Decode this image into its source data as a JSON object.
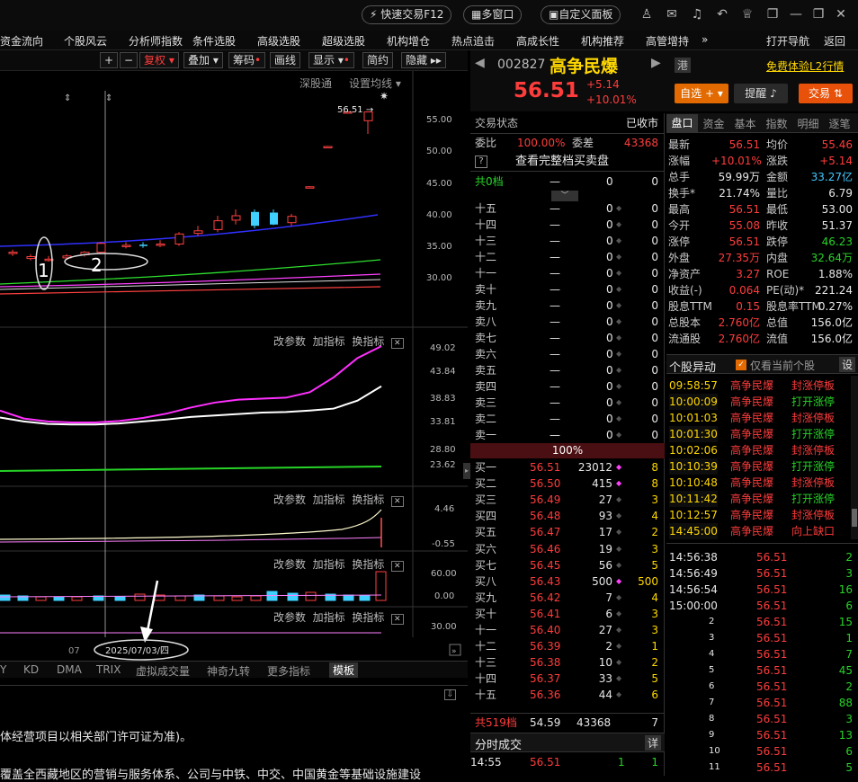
{
  "toolbar": {
    "quick_trade": "快速交易F12",
    "multi_window": "多窗口",
    "custom_panel": "自定义面板"
  },
  "menu": [
    "资金流向",
    "个股风云",
    "分析师指数",
    "条件选股",
    "高级选股",
    "超级选股",
    "机构增仓",
    "热点追击",
    "高成长性",
    "机构推荐",
    "高管增持",
    "»",
    "打开导航",
    "返回"
  ],
  "chart_toolbar": {
    "fuquan": "复权",
    "diejia": "叠加",
    "chouma": "筹码",
    "huaxian": "画线",
    "xianshi": "显示",
    "jianyue": "简约",
    "yincang": "隐藏"
  },
  "chart_sub": {
    "shengang": "深股通",
    "junxian": "设置均线"
  },
  "price_axis": [
    "55.00",
    "50.00",
    "45.00",
    "40.00",
    "35.00",
    "30.00"
  ],
  "last_price_label": "56.51",
  "annotations": {
    "one": "1",
    "two": "2"
  },
  "ind1_axis": [
    "49.02",
    "43.84",
    "38.83",
    "33.81",
    "28.80",
    "23.62"
  ],
  "ind2_axis": [
    "4.46",
    "-0.55"
  ],
  "ind3_axis": [
    "60.00",
    "0.00"
  ],
  "ind4_axis": [
    "30.00"
  ],
  "panel_btns": {
    "gai": "改参数",
    "jia": "加指标",
    "huan": "换指标"
  },
  "date_axis": {
    "tick": "07",
    "cursor": "2025/07/03/四"
  },
  "indicator_tabs": [
    "Y",
    "KD",
    "DMA",
    "TRIX",
    "虚拟成交量",
    "神奇九转",
    "更多指标",
    "模板"
  ],
  "news": {
    "line1": "体经营项目以相关部门许可证为准)。",
    "line2": "覆盖全西藏地区的营销与服务体系、公司与中铁、中交、中国黄金等基础设施建设"
  },
  "stock": {
    "code": "002827",
    "name": "高争民爆",
    "market": "港",
    "price": "56.51",
    "change": "+5.14",
    "pct": "+10.01%",
    "l2": "免费体验L2行情",
    "zixuan": "自选",
    "tixing": "提醒",
    "jiaoyi": "交易"
  },
  "status": {
    "label": "交易状态",
    "value": "已收市",
    "weibi_l": "委比",
    "weibi": "100.00%",
    "weicha_l": "委差",
    "weicha": "43368",
    "full_ob": "查看完整档买卖盘",
    "gong0": "共0档",
    "zero_dash": "—",
    "zero_vals": [
      "0",
      "0"
    ]
  },
  "sells": [
    {
      "l": "十五"
    },
    {
      "l": "十四"
    },
    {
      "l": "十三"
    },
    {
      "l": "十二"
    },
    {
      "l": "十一"
    },
    {
      "l": "卖十"
    },
    {
      "l": "卖九"
    },
    {
      "l": "卖八"
    },
    {
      "l": "卖七"
    },
    {
      "l": "卖六"
    },
    {
      "l": "卖五"
    },
    {
      "l": "卖四"
    },
    {
      "l": "卖三"
    },
    {
      "l": "卖二"
    },
    {
      "l": "卖一"
    }
  ],
  "sell_dash": "—",
  "sell_zero": "0",
  "pct_bar": "100%",
  "buys": [
    {
      "l": "买一",
      "p": "56.51",
      "v": "23012",
      "n": "8"
    },
    {
      "l": "买二",
      "p": "56.50",
      "v": "415",
      "n": "8"
    },
    {
      "l": "买三",
      "p": "56.49",
      "v": "27",
      "n": "3"
    },
    {
      "l": "买四",
      "p": "56.48",
      "v": "93",
      "n": "4"
    },
    {
      "l": "买五",
      "p": "56.47",
      "v": "17",
      "n": "2"
    },
    {
      "l": "买六",
      "p": "56.46",
      "v": "19",
      "n": "3"
    },
    {
      "l": "买七",
      "p": "56.45",
      "v": "56",
      "n": "5"
    },
    {
      "l": "买八",
      "p": "56.43",
      "v": "500",
      "n": "500"
    },
    {
      "l": "买九",
      "p": "56.42",
      "v": "7",
      "n": "4"
    },
    {
      "l": "买十",
      "p": "56.41",
      "v": "6",
      "n": "3"
    },
    {
      "l": "十一",
      "p": "56.40",
      "v": "27",
      "n": "3"
    },
    {
      "l": "十二",
      "p": "56.39",
      "v": "2",
      "n": "1"
    },
    {
      "l": "十三",
      "p": "56.38",
      "v": "10",
      "n": "2"
    },
    {
      "l": "十四",
      "p": "56.37",
      "v": "33",
      "n": "5"
    },
    {
      "l": "十五",
      "p": "56.36",
      "v": "44",
      "n": "6"
    }
  ],
  "buy_total": {
    "l": "共519档",
    "p": "54.59",
    "v": "43368",
    "n": "7"
  },
  "fenshi": {
    "title": "分时成交",
    "btn": "详",
    "t": "14:55",
    "p": "56.51",
    "v": "1",
    "n": "1"
  },
  "tabs_r": [
    "盘口",
    "资金",
    "基本",
    "指数",
    "明细",
    "逐笔"
  ],
  "stats": [
    [
      "最新",
      "56.51",
      "均价",
      "55.46"
    ],
    [
      "涨幅",
      "+10.01%",
      "涨跌",
      "+5.14"
    ],
    [
      "总手",
      "59.99万",
      "金额",
      "33.27亿"
    ],
    [
      "换手*",
      "21.74%",
      "量比",
      "6.79"
    ],
    [
      "最高",
      "56.51",
      "最低",
      "53.00"
    ],
    [
      "今开",
      "55.08",
      "昨收",
      "51.37"
    ],
    [
      "涨停",
      "56.51",
      "跌停",
      "46.23"
    ],
    [
      "外盘",
      "27.35万",
      "内盘",
      "32.64万"
    ],
    [
      "净资产",
      "3.27",
      "ROE",
      "1.88%"
    ],
    [
      "收益(-)",
      "0.064",
      "PE(动)*",
      "221.24"
    ],
    [
      "股息TTM",
      "0.15",
      "股息率TTM",
      "0.27%"
    ],
    [
      "总股本",
      "2.760亿",
      "总值",
      "156.0亿"
    ],
    [
      "流通股",
      "2.760亿",
      "流值",
      "156.0亿"
    ]
  ],
  "yidong": {
    "title": "个股异动",
    "check": "仅看当前个股",
    "btn": "设",
    "rows": [
      [
        "09:58:57",
        "高争民爆",
        "封涨停板"
      ],
      [
        "10:00:09",
        "高争民爆",
        "打开涨停"
      ],
      [
        "10:01:03",
        "高争民爆",
        "封涨停板"
      ],
      [
        "10:01:30",
        "高争民爆",
        "打开涨停"
      ],
      [
        "10:02:06",
        "高争民爆",
        "封涨停板"
      ],
      [
        "10:10:39",
        "高争民爆",
        "打开涨停"
      ],
      [
        "10:10:48",
        "高争民爆",
        "封涨停板"
      ],
      [
        "10:11:42",
        "高争民爆",
        "打开涨停"
      ],
      [
        "10:12:57",
        "高争民爆",
        "封涨停板"
      ],
      [
        "14:45:00",
        "高争民爆",
        "向上缺口"
      ]
    ]
  },
  "ticks": [
    [
      "14:56:38",
      "56.51",
      "2"
    ],
    [
      "14:56:49",
      "56.51",
      "3"
    ],
    [
      "14:56:54",
      "56.51",
      "16"
    ],
    [
      "15:00:00",
      "56.51",
      "6"
    ],
    [
      "2",
      "56.51",
      "15"
    ],
    [
      "3",
      "56.51",
      "1"
    ],
    [
      "4",
      "56.51",
      "7"
    ],
    [
      "5",
      "56.51",
      "45"
    ],
    [
      "6",
      "56.51",
      "2"
    ],
    [
      "7",
      "56.51",
      "88"
    ],
    [
      "8",
      "56.51",
      "3"
    ],
    [
      "9",
      "56.51",
      "13"
    ],
    [
      "10",
      "56.51",
      "6"
    ],
    [
      "11",
      "56.51",
      "5"
    ]
  ],
  "chart_data": [
    {
      "type": "candlestick",
      "title": "",
      "series": [
        {
          "name": "",
          "values": [
            [
              34.1,
              34.6,
              33.6,
              34.2
            ],
            [
              33.2,
              33.9,
              32.9,
              33.5
            ],
            [
              33.0,
              33.6,
              32.7,
              33.1
            ],
            [
              33.3,
              33.9,
              33.0,
              33.6
            ],
            [
              33.8,
              34.4,
              33.5,
              34.2
            ],
            [
              34.2,
              35.8,
              34.0,
              35.6
            ],
            [
              35.1,
              35.8,
              34.8,
              35.3
            ],
            [
              35.4,
              35.8,
              34.9,
              35.3
            ],
            [
              35.3,
              36.1,
              35.0,
              35.5
            ],
            [
              35.5,
              37.4,
              35.2,
              37.1
            ],
            [
              37.2,
              38.4,
              36.8,
              37.6
            ],
            [
              37.8,
              40.0,
              37.4,
              39.2
            ],
            [
              39.3,
              41.0,
              38.6,
              40.0
            ],
            [
              40.6,
              41.0,
              38.0,
              38.4
            ],
            [
              40.5,
              41.0,
              38.5,
              38.6
            ],
            [
              38.9,
              40.3,
              38.4,
              39.9
            ],
            [
              44.6,
              44.7,
              44.4,
              44.6
            ],
            [
              51.0,
              51.1,
              50.9,
              51.0
            ],
            [
              56.5,
              56.6,
              56.4,
              56.5
            ],
            [
              55.1,
              56.5,
              53.0,
              56.5
            ]
          ]
        }
      ],
      "ylim": [
        27.0,
        58.0
      ]
    },
    {
      "type": "line",
      "title": "",
      "series": [
        {
          "name": "",
          "values": [
            36,
            34.4,
            33.8,
            33.6,
            33.6,
            33.9,
            34.5,
            35.4,
            36.6,
            37.6,
            38.2,
            38.4,
            38.6,
            39.7,
            42.7,
            46.6,
            49.0
          ]
        },
        {
          "name": "",
          "values": [
            34.6,
            33.8,
            33.3,
            33.2,
            33.2,
            33.4,
            33.8,
            34.2,
            34.7,
            35.0,
            35.3,
            35.6,
            35.7,
            36.0,
            36.4,
            38.0,
            40.9
          ]
        }
      ],
      "ylim": [
        23.62,
        49.02
      ]
    }
  ]
}
